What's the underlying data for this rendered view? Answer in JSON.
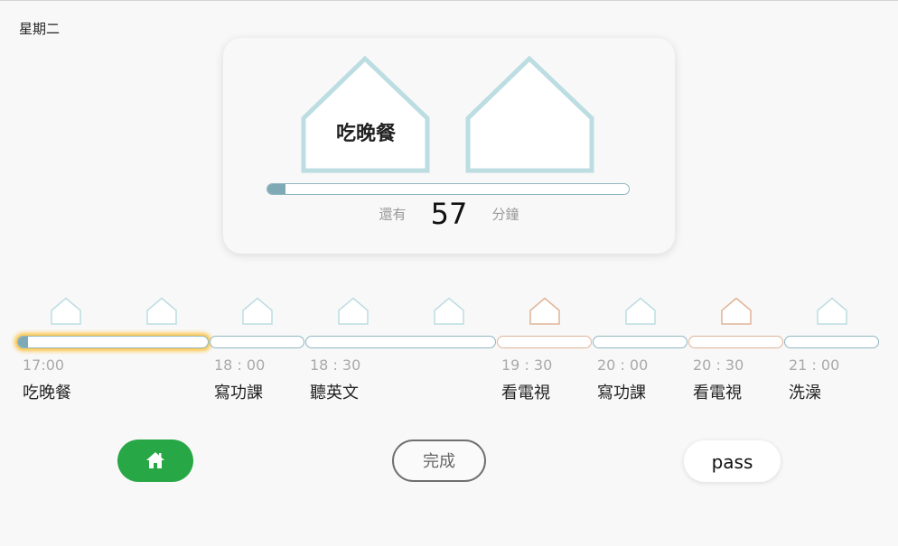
{
  "header": {
    "weekday": "星期二"
  },
  "current": {
    "activity": "吃晚餐",
    "progress_fraction": 0.05,
    "remaining_prefix": "還有",
    "remaining_minutes": "57",
    "remaining_unit": "分鐘"
  },
  "timeline": {
    "icon": "house-icon",
    "entries": [
      {
        "time": "17:00",
        "name": "吃晚餐",
        "type": "normal",
        "active": true,
        "progress_fraction": 0.05
      },
      {
        "time": "18 : 00",
        "name": "寫功課",
        "type": "normal",
        "active": false,
        "progress_fraction": 0
      },
      {
        "time": "18 : 30",
        "name": "聽英文",
        "type": "normal",
        "active": false,
        "progress_fraction": 0
      },
      {
        "time": "19 : 30",
        "name": "看電視",
        "type": "tv",
        "active": false,
        "progress_fraction": 0
      },
      {
        "time": "20 : 00",
        "name": "寫功課",
        "type": "normal",
        "active": false,
        "progress_fraction": 0
      },
      {
        "time": "20 : 30",
        "name": "看電視",
        "type": "tv",
        "active": false,
        "progress_fraction": 0
      },
      {
        "time": "21 : 00",
        "name": "洗澡",
        "type": "normal",
        "active": false,
        "progress_fraction": 0
      }
    ]
  },
  "buttons": {
    "home_icon": "home-icon",
    "done_label": "完成",
    "pass_label": "pass"
  },
  "colors": {
    "house_normal": "#bcdde2",
    "house_tv": "#e0b497",
    "bar_border": "#8fb7c1",
    "bar_fill": "#7fa9b4",
    "active_glow": "#ffb000",
    "home_button": "#27a745"
  }
}
